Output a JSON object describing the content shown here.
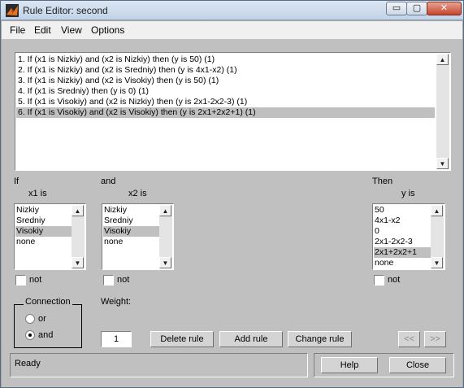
{
  "window": {
    "title": "Rule Editor: second",
    "minimize_glyph": "▭",
    "maximize_glyph": "▢",
    "close_glyph": "✕"
  },
  "menu": [
    "File",
    "Edit",
    "View",
    "Options"
  ],
  "rules": [
    "1. If (x1 is Nizkiy) and (x2 is Nizkiy) then (y is 50) (1)",
    "2. If (x1 is Nizkiy) and (x2 is Sredniy) then (y is 4x1-x2) (1)",
    "3. If (x1 is Nizkiy) and (x2 is Visokiy) then (y is 50) (1)",
    "4. If (x1 is Sredniy) then (y is 0) (1)",
    "5. If (x1 is Visokiy) and (x2 is Nizkiy) then (y is 2x1-2x2-3) (1)",
    "6. If (x1 is Visokiy) and (x2 is Visokiy) then (y is 2x1+2x2+1) (1)"
  ],
  "selected_rule_index": 5,
  "if_label": "If",
  "and_label": "and",
  "then_label": "Then",
  "x1": {
    "title": "x1 is",
    "options": [
      "Nizkiy",
      "Sredniy",
      "Visokiy",
      "none"
    ],
    "selected_index": 2,
    "not_label": "not",
    "not_checked": false
  },
  "x2": {
    "title": "x2 is",
    "options": [
      "Nizkiy",
      "Sredniy",
      "Visokiy",
      "none"
    ],
    "selected_index": 2,
    "not_label": "not",
    "not_checked": false
  },
  "y": {
    "title": "y is",
    "options": [
      "50",
      "4x1-x2",
      "0",
      "2x1-2x2-3",
      "2x1+2x2+1",
      "none"
    ],
    "selected_index": 4,
    "not_label": "not",
    "not_checked": false
  },
  "connection": {
    "title": "Connection",
    "options": [
      "or",
      "and"
    ],
    "selected": "and"
  },
  "weight": {
    "label": "Weight:",
    "value": "1"
  },
  "buttons": {
    "delete_rule": "Delete rule",
    "add_rule": "Add rule",
    "change_rule": "Change rule",
    "prev": "<<",
    "next": ">>",
    "help": "Help",
    "close": "Close"
  },
  "status": "Ready",
  "scroll_arrows": {
    "up": "▲",
    "down": "▼"
  }
}
